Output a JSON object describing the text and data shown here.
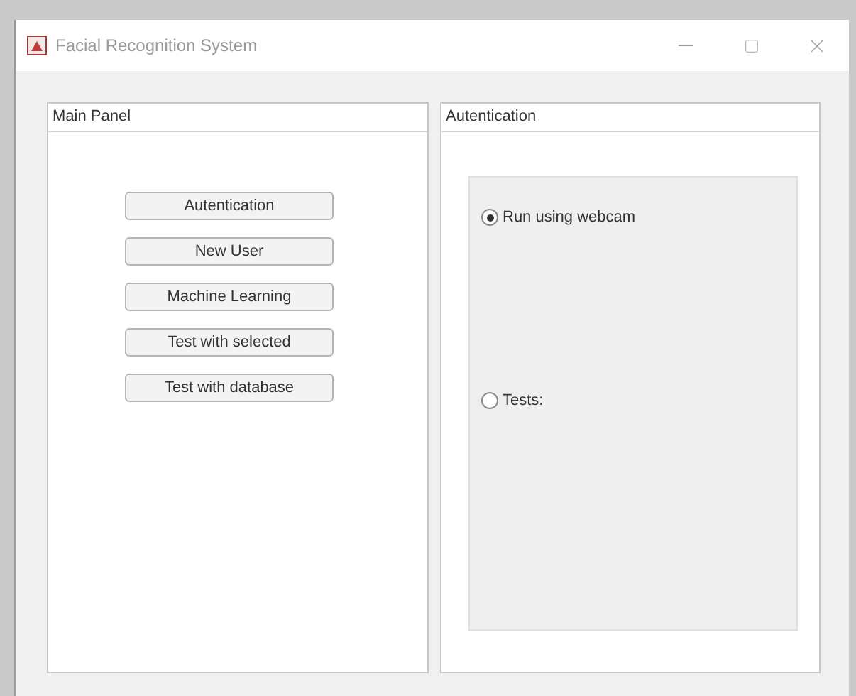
{
  "window": {
    "title": "Facial Recognition System"
  },
  "main_panel": {
    "title": "Main Panel",
    "buttons": [
      "Autentication",
      "New User",
      "Machine Learning",
      "Test with selected",
      "Test with database"
    ]
  },
  "auth_panel": {
    "title": "Autentication",
    "options": [
      {
        "label": "Run using webcam",
        "selected": true
      },
      {
        "label": "Tests:",
        "selected": false
      }
    ]
  }
}
